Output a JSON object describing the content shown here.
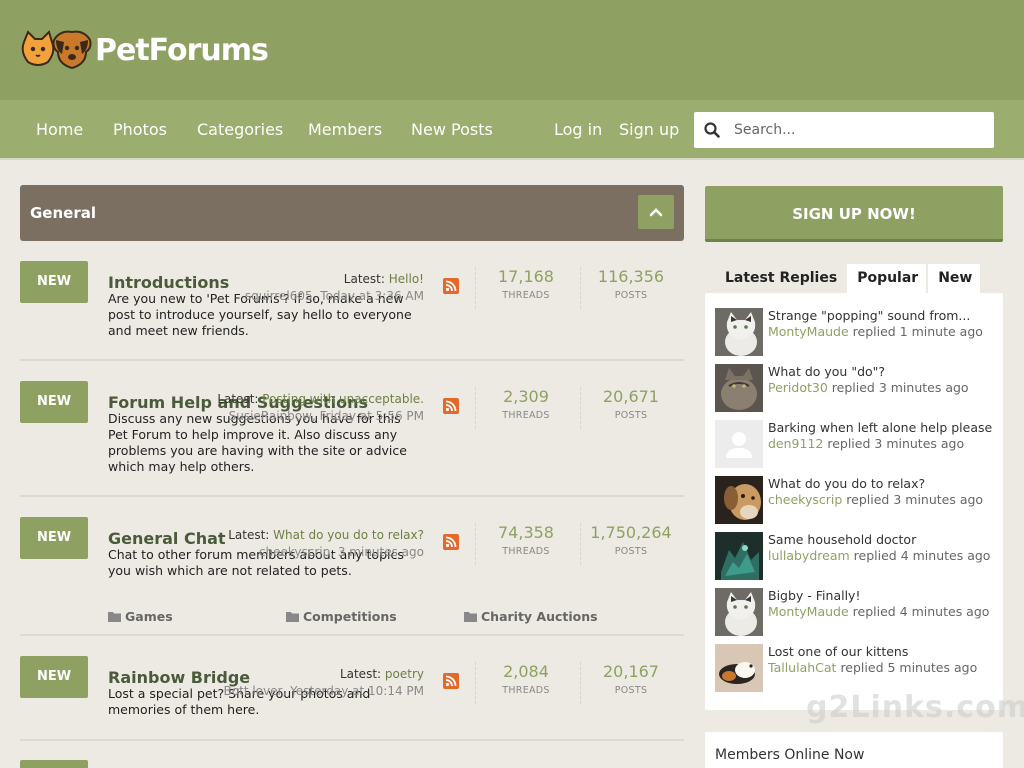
{
  "header": {
    "logo_text": "PetForums"
  },
  "nav": {
    "items": [
      "Home",
      "Photos",
      "Categories",
      "Members",
      "New Posts"
    ],
    "login": "Log in",
    "signup": "Sign up",
    "search_placeholder": "Search..."
  },
  "section": {
    "title": "General"
  },
  "forums": [
    {
      "badge": "NEW",
      "title": "Introductions",
      "description": "Are you new to 'Pet Forums'? If so, make a new post to introduce yourself, say hello to everyone and meet new friends.",
      "latest_label": "Latest:",
      "latest_title": "Hello!",
      "latest_meta": "squirrel605, Today at 3:36 AM",
      "threads": "17,168",
      "posts": "116,356"
    },
    {
      "badge": "NEW",
      "title": "Forum Help and Suggestions",
      "description": "Discuss any new suggestions you have for this Pet Forum to help improve it. Also discuss any problems you are having with the site or advice which may help others.",
      "latest_label": "Latest:",
      "latest_title": "Posting with unacceptable.",
      "latest_meta": "SusieRainbow, Friday at 5:56 PM",
      "threads": "2,309",
      "posts": "20,671"
    },
    {
      "badge": "NEW",
      "title": "General Chat",
      "description": "Chat to other forum members about any topics you wish which are not related to pets.",
      "latest_label": "Latest:",
      "latest_title": "What do you do to relax?",
      "latest_meta": "cheekyscrip, 3 minutes ago",
      "threads": "74,358",
      "posts": "1,750,264",
      "subforums": [
        "Games",
        "Competitions",
        "Charity Auctions"
      ]
    },
    {
      "badge": "NEW",
      "title": "Rainbow Bridge",
      "description": "Lost a special pet? Share your photos and memories of them here.",
      "latest_label": "Latest:",
      "latest_title": "poetry",
      "latest_meta": "Bott lover, Yesterday at 10:14 PM",
      "threads": "2,084",
      "posts": "20,167"
    }
  ],
  "stats_labels": {
    "threads": "THREADS",
    "posts": "POSTS"
  },
  "sidebar": {
    "signup_button": "SIGN UP NOW!",
    "tabs": [
      "Latest Replies",
      "Popular",
      "New"
    ],
    "replied_word": "replied",
    "replies": [
      {
        "title": "Strange \"popping\" sound from...",
        "user": "MontyMaude",
        "time": "1 minute ago"
      },
      {
        "title": "What do you \"do\"?",
        "user": "Peridot30",
        "time": "3 minutes ago"
      },
      {
        "title": "Barking when left alone help please",
        "user": "den9112",
        "time": "3 minutes ago"
      },
      {
        "title": "What do you do to relax?",
        "user": "cheekyscrip",
        "time": "3 minutes ago"
      },
      {
        "title": "Same household doctor",
        "user": "lullabydream",
        "time": "4 minutes ago"
      },
      {
        "title": "Bigby - Finally!",
        "user": "MontyMaude",
        "time": "4 minutes ago"
      },
      {
        "title": "Lost one of our kittens",
        "user": "TallulahCat",
        "time": "5 minutes ago"
      }
    ],
    "members_online_title": "Members Online Now"
  },
  "watermark": "g2Links.com",
  "colors": {
    "brand_green": "#8ea162",
    "nav_green": "#9bad6f",
    "section_brown": "#7a6f61",
    "background": "#edeae3"
  }
}
